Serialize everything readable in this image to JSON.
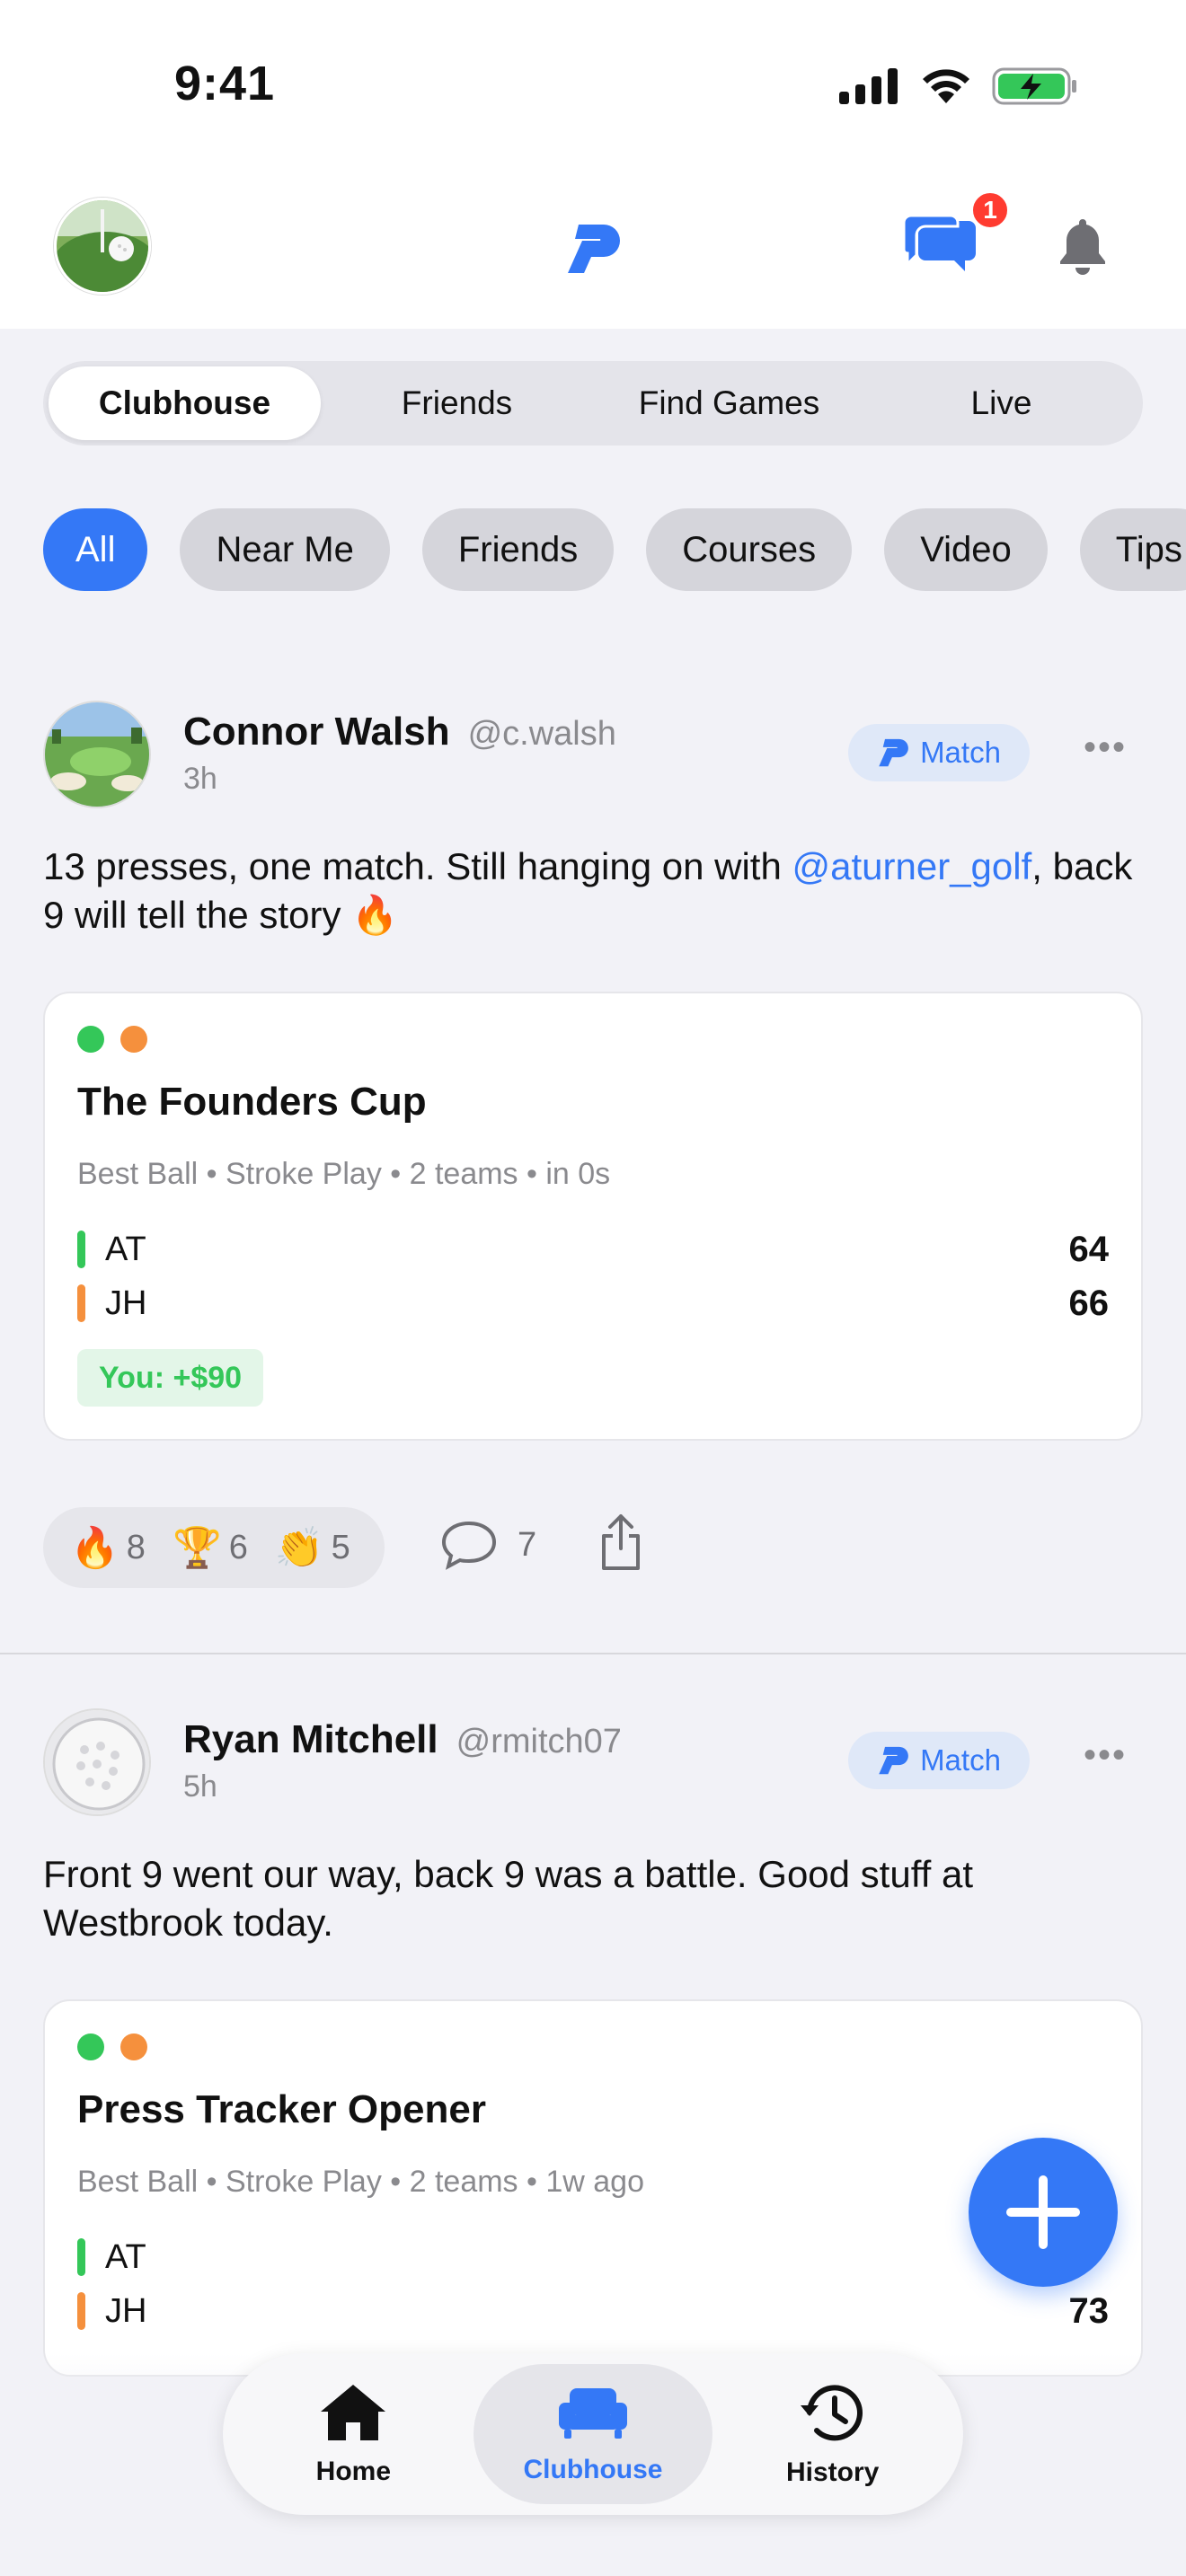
{
  "status_bar": {
    "time": "9:41"
  },
  "header": {
    "messages_badge": "1"
  },
  "segment_tabs": [
    {
      "label": "Clubhouse",
      "active": true
    },
    {
      "label": "Friends",
      "active": false
    },
    {
      "label": "Find Games",
      "active": false
    },
    {
      "label": "Live",
      "active": false
    }
  ],
  "filter_chips": [
    {
      "label": "All",
      "active": true
    },
    {
      "label": "Near Me",
      "active": false
    },
    {
      "label": "Friends",
      "active": false
    },
    {
      "label": "Courses",
      "active": false
    },
    {
      "label": "Video",
      "active": false
    },
    {
      "label": "Tips",
      "active": false
    }
  ],
  "posts": [
    {
      "name": "Connor Walsh",
      "handle": "@c.walsh",
      "time": "3h",
      "tag": "Match",
      "text_before": "13 presses, one match. Still hanging on with ",
      "mention": "@aturner_golf",
      "text_after": ", back 9 will tell the story 🔥",
      "card": {
        "title": "The Founders Cup",
        "meta": "Best Ball • Stroke Play  •  2 teams  •  in 0s",
        "teams": [
          {
            "name": "AT",
            "score": "64",
            "color": "#34c759"
          },
          {
            "name": "JH",
            "score": "66",
            "color": "#f5903d"
          }
        ],
        "you": "You: +$90"
      },
      "reactions": [
        {
          "emoji": "🔥",
          "count": "8"
        },
        {
          "emoji": "🏆",
          "count": "6"
        },
        {
          "emoji": "👏",
          "count": "5"
        }
      ],
      "comments": "7"
    },
    {
      "name": "Ryan Mitchell",
      "handle": "@rmitch07",
      "time": "5h",
      "tag": "Match",
      "text": "Front 9 went our way, back 9 was a battle. Good stuff at Westbrook today.",
      "card": {
        "title": "Press Tracker Opener",
        "meta": "Best Ball • Stroke Play  •  2 teams  •  1w ago",
        "teams": [
          {
            "name": "AT",
            "score": "",
            "color": "#34c759"
          },
          {
            "name": "JH",
            "score": "73",
            "color": "#f5903d"
          }
        ]
      }
    }
  ],
  "bottom_nav": [
    {
      "label": "Home",
      "icon": "home-icon",
      "active": false
    },
    {
      "label": "Clubhouse",
      "icon": "couch-icon",
      "active": true
    },
    {
      "label": "History",
      "icon": "history-icon",
      "active": false
    }
  ],
  "colors": {
    "accent": "#3478f6",
    "green": "#34c759",
    "orange": "#f5903d",
    "badge": "#ff3b30"
  }
}
